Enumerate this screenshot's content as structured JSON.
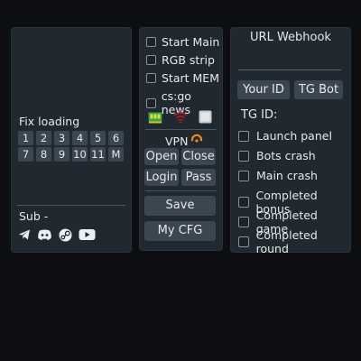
{
  "left_panel": {
    "fix_loading_label": "Fix loading",
    "buttons": [
      "1",
      "2",
      "3",
      "4",
      "5",
      "6",
      "7",
      "8",
      "9",
      "10",
      "11",
      "M"
    ],
    "sub_label": "Sub -",
    "social_icons": [
      "telegram-icon",
      "discord-icon",
      "steam-icon",
      "youtube-icon"
    ]
  },
  "middle_panel": {
    "checkboxes": [
      {
        "label": "Start Main",
        "checked": false
      },
      {
        "label": "RGB strip",
        "checked": false
      },
      {
        "label": "Start MEM",
        "checked": false
      },
      {
        "label": "cs:go news",
        "checked": false
      }
    ],
    "icons": [
      "ram-icon",
      "wifi-icon",
      "square-icon"
    ],
    "vpn_label": "VPN",
    "buttons": {
      "open": "Open",
      "close": "Close",
      "login": "Login",
      "pass": "Pass",
      "save": "Save",
      "my_cfg": "My CFG"
    }
  },
  "right_panel": {
    "title": "URL Webhook",
    "webhook_value": "",
    "your_id_button": "Your ID",
    "tg_bot_button": "TG Bot",
    "tg_id_label": "TG ID:",
    "checkboxes": [
      {
        "label": "Launch panel",
        "checked": false
      },
      {
        "label": "Bots crash",
        "checked": false
      },
      {
        "label": "Main crash",
        "checked": false
      },
      {
        "label": "Completed bonus",
        "checked": false
      },
      {
        "label": "Completed game",
        "checked": false
      },
      {
        "label": "Completed round",
        "checked": false
      }
    ]
  },
  "colors": {
    "background": "#0c0e11",
    "panel": "#212930",
    "button": "#3b4650",
    "vpn_accent": "#f28a1c",
    "wifi_accent": "#b0202a",
    "ram_accent": "#2fa84a"
  }
}
